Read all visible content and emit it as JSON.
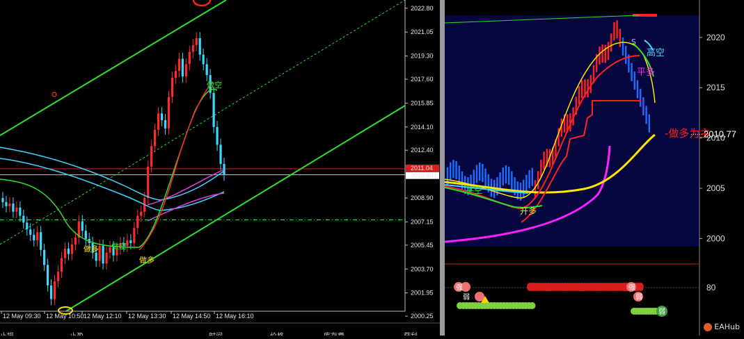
{
  "chart_data": [
    {
      "type": "candlestick",
      "title": "",
      "price_axis": {
        "ticks": [
          "2022.80",
          "2021.05",
          "2019.30",
          "2017.60",
          "2015.85",
          "2014.10",
          "2012.40",
          "2011.04",
          "2010.60",
          "2008.90",
          "2007.15",
          "2005.45",
          "2003.70",
          "2001.95",
          "2000.25"
        ],
        "range": [
          2000.0,
          2023.4
        ]
      },
      "time_axis": {
        "ticks": [
          "12 May 09:30",
          "12 May 10:50",
          "12 May 12:10",
          "12 May 13:30",
          "12 May 14:50",
          "12 May 16:10"
        ]
      },
      "price_labels": {
        "red_line": "2011.04",
        "current": "2010.60"
      },
      "annotations": [
        "做多",
        "做空",
        "做多",
        "做空"
      ],
      "bottom_tabs": [
        "止损",
        "止盈",
        "时间",
        "价格",
        "库存费",
        "获利"
      ],
      "candles_close": [
        2008.6,
        2008.3,
        2008.5,
        2007.9,
        2008.2,
        2007.6,
        2007.1,
        2006.6,
        2006.2,
        2005.8,
        2006.4,
        2005.1,
        2004.0,
        2002.5,
        2001.5,
        2002.8,
        2003.5,
        2004.5,
        2005.2,
        2004.8,
        2005.5,
        2006.0,
        2007.2,
        2006.5,
        2005.9,
        2005.6,
        2004.9,
        2004.3,
        2005.4,
        2004.1,
        2004.9,
        2005.3,
        2004.7,
        2005.2,
        2005.6,
        2005.4,
        2005.8,
        2005.6,
        2006.7,
        2007.6,
        2007.9,
        2008.9,
        2011.2,
        2012.7,
        2013.9,
        2015.1,
        2014.6,
        2014.0,
        2016.3,
        2017.7,
        2018.2,
        2019.1,
        2017.8,
        2018.7,
        2019.6,
        2020.1,
        2020.6,
        2019.4,
        2018.7,
        2017.9,
        2016.6,
        2014.1,
        2012.8,
        2011.4,
        2010.6
      ]
    },
    {
      "type": "indicator-chart",
      "price_axis": {
        "ticks": [
          "2020",
          "2015",
          "2010",
          "2005",
          "2000"
        ],
        "range": [
          1999.2,
          2022.2
        ]
      },
      "current_price": "2010.77",
      "signal_text": "-做多为主",
      "annotations": [
        "S",
        "高空",
        "平多",
        "平空",
        "开多"
      ],
      "oscillator_axis": {
        "ticks": [
          "80"
        ]
      },
      "oscillator_labels": [
        "强",
        "弱",
        "多"
      ]
    }
  ],
  "watermark": "EAHub",
  "colors": {
    "bull": "#ff2a2a",
    "bear": "#3fd8ff",
    "channel": "#2fe02f",
    "panel_bg": "#07073f"
  }
}
